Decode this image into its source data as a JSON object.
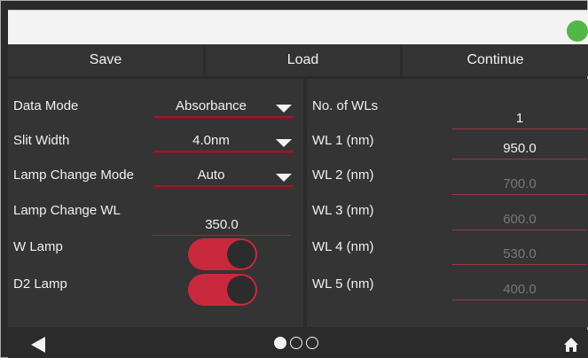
{
  "toolbar": {
    "save_label": "Save",
    "load_label": "Load",
    "continue_label": "Continue"
  },
  "left_panel": {
    "data_mode": {
      "label": "Data Mode",
      "value": "Absorbance"
    },
    "slit_width": {
      "label": "Slit Width",
      "value": "4.0nm"
    },
    "lamp_change_mode": {
      "label": "Lamp Change Mode",
      "value": "Auto"
    },
    "lamp_change_wl": {
      "label": "Lamp Change WL",
      "value": "350.0"
    },
    "w_lamp": {
      "label": "W Lamp",
      "state": "on"
    },
    "d2_lamp": {
      "label": "D2 Lamp",
      "state": "on"
    }
  },
  "right_panel": {
    "num_wls": {
      "label": "No. of WLs",
      "value": "1"
    },
    "wavelengths": [
      {
        "label": "WL 1 (nm)",
        "value": "950.0",
        "active": true
      },
      {
        "label": "WL 2 (nm)",
        "value": "700.0",
        "active": false
      },
      {
        "label": "WL 3 (nm)",
        "value": "600.0",
        "active": false
      },
      {
        "label": "WL 4 (nm)",
        "value": "530.0",
        "active": false
      },
      {
        "label": "WL 5 (nm)",
        "value": "400.0",
        "active": false
      }
    ]
  },
  "bottom_nav": {
    "icons": [
      "back-arrow-icon",
      "home-icon"
    ],
    "pages": 3,
    "current_page": 1
  },
  "colors": {
    "accent": "#c8293d",
    "status_ok": "#53b748",
    "panel_bg": "#343434"
  }
}
